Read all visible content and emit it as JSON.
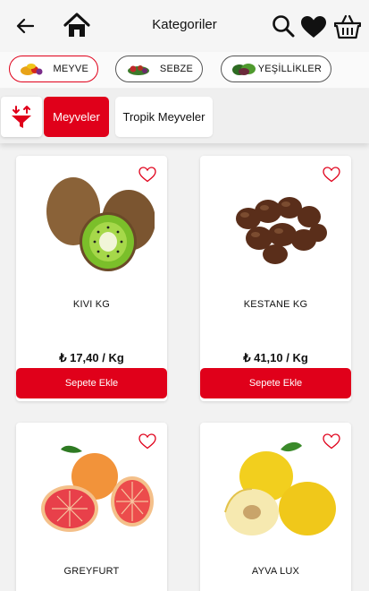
{
  "header": {
    "title": "Kategoriler",
    "icons": [
      "back-arrow-icon",
      "home-icon",
      "search-icon",
      "heart-icon",
      "basket-icon"
    ]
  },
  "categories": [
    {
      "label": "MEYVE",
      "active": true
    },
    {
      "label": "SEBZE",
      "active": false
    },
    {
      "label": "YEŞİLLİKLER",
      "active": false
    }
  ],
  "subcategories": [
    {
      "label": "Meyveler",
      "active": true
    },
    {
      "label": "Tropik Meyveler",
      "active": false
    }
  ],
  "products": [
    {
      "name": "KIVI KG",
      "price": "₺ 17,40 / Kg",
      "button": "Sepete Ekle"
    },
    {
      "name": "KESTANE KG",
      "price": "₺ 41,10 / Kg",
      "button": "Sepete Ekle"
    },
    {
      "name": "GREYFURT",
      "price": "",
      "button": ""
    },
    {
      "name": "AYVA LUX",
      "price": "",
      "button": ""
    }
  ],
  "colors": {
    "accent": "#e0001a",
    "background": "#f2f2f2"
  }
}
